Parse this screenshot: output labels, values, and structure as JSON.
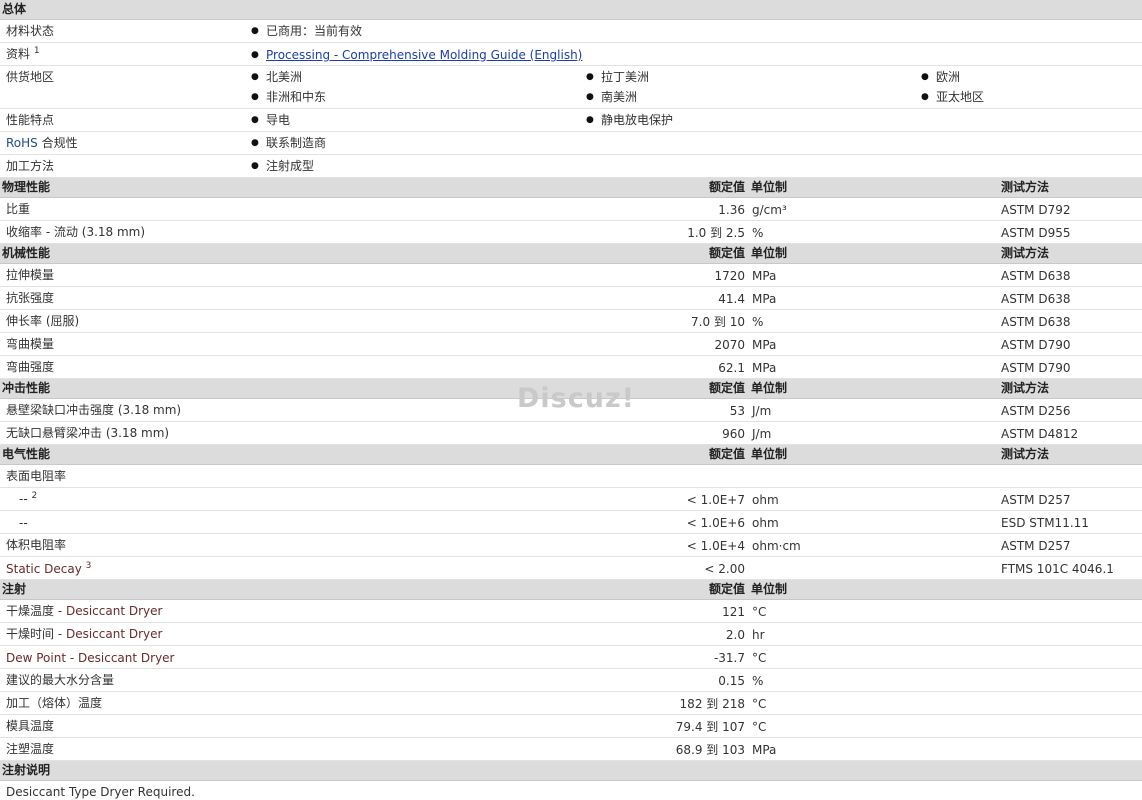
{
  "sections": {
    "general": "总体",
    "physical": "物理性能",
    "mechanical": "机械性能",
    "impact": "冲击性能",
    "electrical": "电气性能",
    "injection": "注射",
    "injection_notes": "注射说明"
  },
  "headers": {
    "nominal": "额定值",
    "unit": "单位制",
    "test": "测试方法"
  },
  "general": {
    "material_status_label": "材料状态",
    "material_status_value": "已商用：当前有效",
    "literature_label": "资料",
    "literature_sup": "1",
    "literature_link": "Processing - Comprehensive Molding Guide (English)",
    "availability_label": "供货地区",
    "regions": [
      "北美洲",
      "拉丁美洲",
      "欧洲",
      "非洲和中东",
      "南美洲",
      "亚太地区"
    ],
    "features_label": "性能特点",
    "features": [
      "导电",
      "静电放电保护"
    ],
    "rohs_label_a": "RoHS",
    "rohs_label_b": " 合规性",
    "rohs_value": "联系制造商",
    "processing_label": "加工方法",
    "processing_value": "注射成型"
  },
  "physical_rows": [
    {
      "label": "比重",
      "value": "1.36",
      "unit": "g/cm³",
      "test": "ASTM D792"
    },
    {
      "label": "收缩率  - 流动  (3.18 mm)",
      "value": "1.0 到  2.5",
      "unit": "%",
      "test": "ASTM D955"
    }
  ],
  "mechanical_rows": [
    {
      "label": "拉伸模量",
      "value": "1720",
      "unit": "MPa",
      "test": "ASTM D638"
    },
    {
      "label": "抗张强度",
      "value": "41.4",
      "unit": "MPa",
      "test": "ASTM D638"
    },
    {
      "label": "伸长率  (屈服)",
      "value": "7.0 到  10",
      "unit": "%",
      "test": "ASTM D638"
    },
    {
      "label": "弯曲模量",
      "value": "2070",
      "unit": "MPa",
      "test": "ASTM D790"
    },
    {
      "label": "弯曲强度",
      "value": "62.1",
      "unit": "MPa",
      "test": "ASTM D790"
    }
  ],
  "impact_rows": [
    {
      "label": "悬壁梁缺口冲击强度  (3.18 mm)",
      "value": "53",
      "unit": "J/m",
      "test": "ASTM D256"
    },
    {
      "label": "无缺口悬臂梁冲击  (3.18 mm)",
      "value": "960",
      "unit": "J/m",
      "test": "ASTM D4812"
    }
  ],
  "electrical": {
    "surface_label": "表面电阻率",
    "row1_label": "--",
    "row1_sup": "2",
    "row1_value": "< 1.0E+7",
    "row1_unit": "ohm",
    "row1_test": "ASTM D257",
    "row2_label": "--",
    "row2_value": "< 1.0E+6",
    "row2_unit": "ohm",
    "row2_test": "ESD STM11.11",
    "volume_label": "体积电阻率",
    "volume_value": "< 1.0E+4",
    "volume_unit": "ohm·cm",
    "volume_test": "ASTM D257",
    "static_label": "Static Decay",
    "static_sup": "3",
    "static_value": "< 2.00",
    "static_test": "FTMS 101C 4046.1"
  },
  "injection": {
    "dry_temp_label_a": "干燥温度",
    "dry_temp_label_b": "  - Desiccant Dryer",
    "dry_temp_value": "121",
    "dry_temp_unit": "°C",
    "dry_time_label_a": "干燥时间",
    "dry_time_label_b": "  - Desiccant Dryer",
    "dry_time_value": "2.0",
    "dry_time_unit": "hr",
    "dew_label": "Dew Point - Desiccant Dryer",
    "dew_value": "-31.7",
    "dew_unit": "°C",
    "moisture_label": "建议的最大水分含量",
    "moisture_value": "0.15",
    "moisture_unit": "%",
    "melt_label": "加工（熔体）温度",
    "melt_value": "182 到  218",
    "melt_unit": "°C",
    "mold_label": "模具温度",
    "mold_value": "79.4 到  107",
    "mold_unit": "°C",
    "inj_pressure_label": "注塑温度",
    "inj_pressure_value": "68.9 到  103",
    "inj_pressure_unit": "MPa"
  },
  "notes": {
    "text": "Desiccant Type Dryer Required."
  },
  "watermark": "Discuz!"
}
